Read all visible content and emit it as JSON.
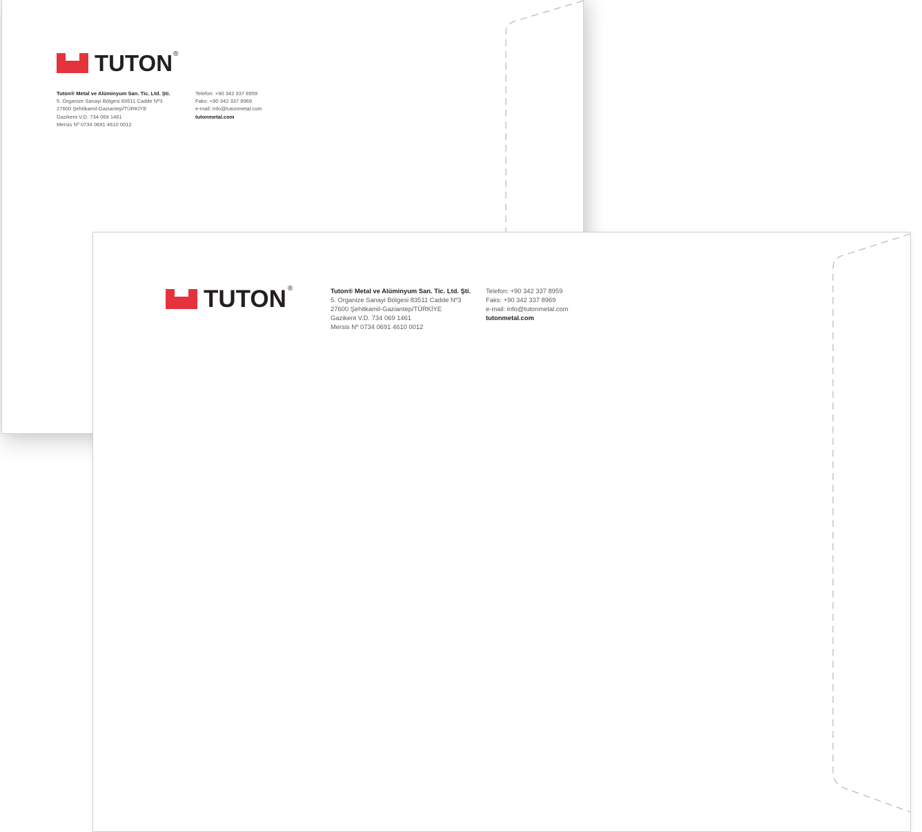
{
  "brand": {
    "name": "TUTON",
    "registered": "®",
    "color": "#e5333d",
    "text_color": "#231f20"
  },
  "company": {
    "name_line": "Tuton® Metal ve Alüminyum San. Tic. Ltd. Şti.",
    "address_line1": "5. Organize Sanayi Bölgesi 83511 Cadde Nº3",
    "address_line2": "27600 Şehitkamil-Gaziantep/TÜRKİYE",
    "tax_line": "Gazikent V.D. 734 069 1461",
    "mersis_line": "Mersis Nº 0734 0691 4610 0012"
  },
  "contact": {
    "phone": "Telefon: +90 342 337 8959",
    "fax": "Faks: +90 342 337 8969",
    "email": "e-mail: info@tutonmetal.com",
    "website": "tutonmetal.com"
  }
}
